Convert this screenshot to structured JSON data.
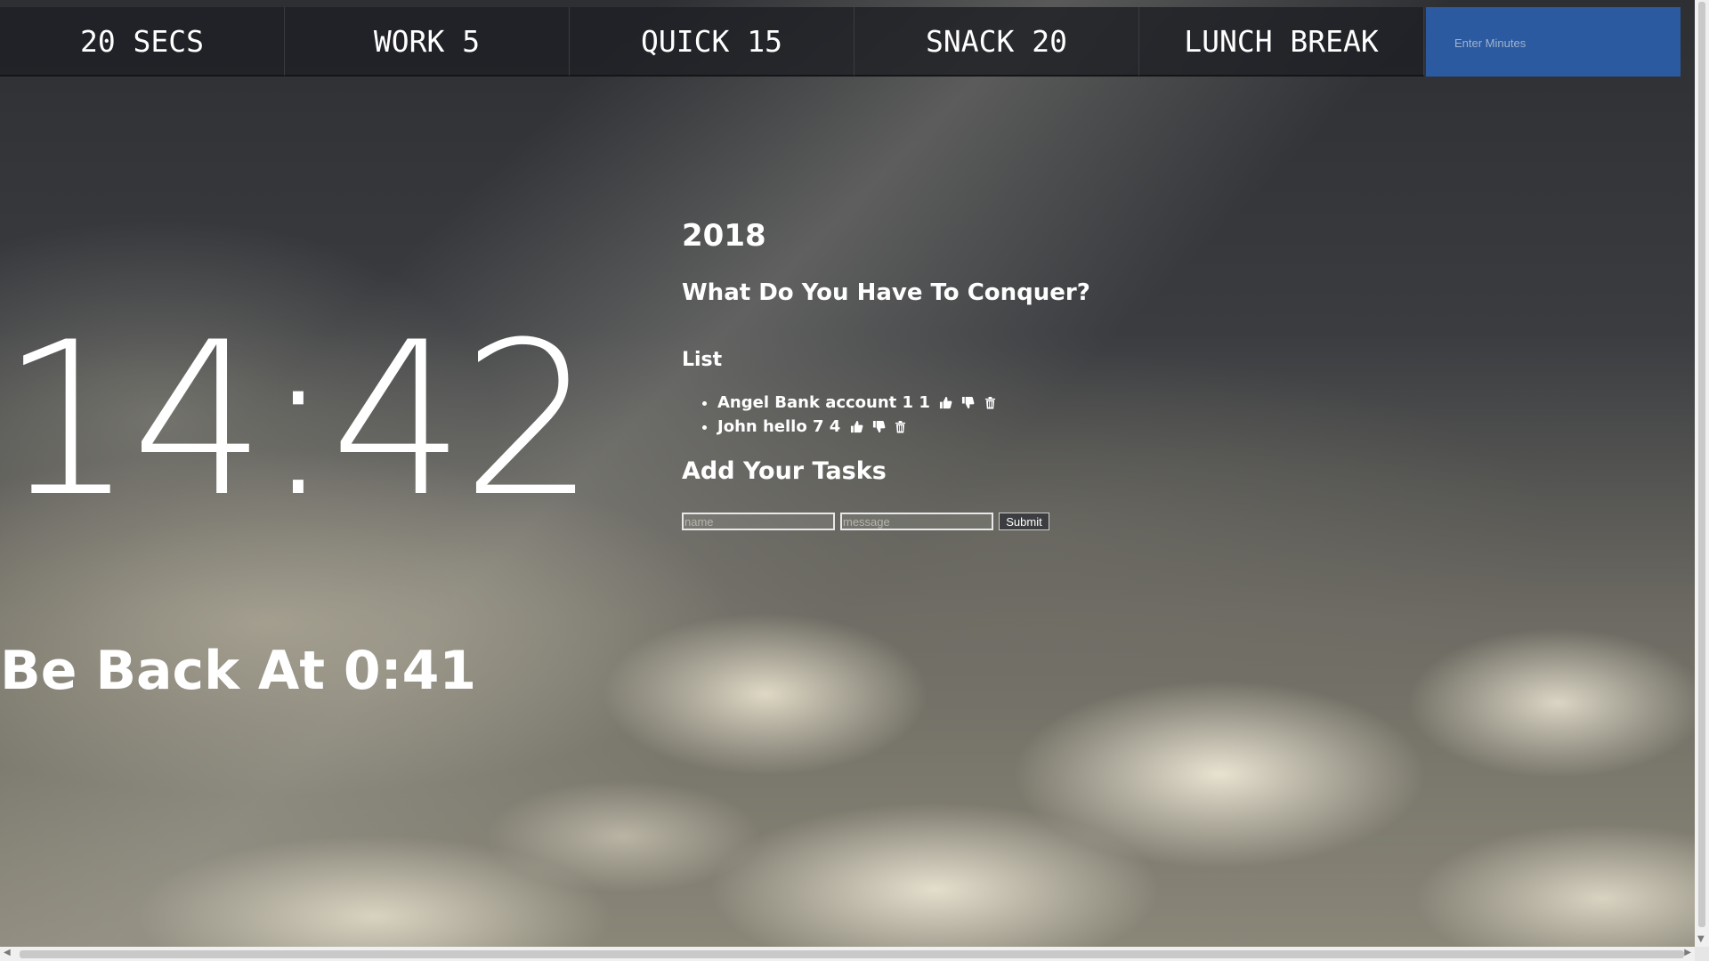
{
  "nav": {
    "buttons": [
      "20 SECS",
      "WORK 5",
      "QUICK 15",
      "SNACK 20",
      "LUNCH BREAK"
    ],
    "minutes_placeholder": "Enter Minutes",
    "accent_color": "#2b5aa0"
  },
  "clock": {
    "time": "14:42",
    "back_at": "Be Back At 0:41"
  },
  "panel": {
    "year": "2018",
    "question": "What Do You Have To Conquer?",
    "list_title": "List",
    "tasks": [
      {
        "text": "Angel Bank account 1 1",
        "icons": [
          "thumbs-up-icon",
          "thumbs-down-icon",
          "trash-icon"
        ]
      },
      {
        "text": "John hello 7 4",
        "icons": [
          "thumbs-up-icon",
          "thumbs-down-icon",
          "trash-icon"
        ]
      }
    ],
    "add_title": "Add Your Tasks",
    "form": {
      "name_placeholder": "name",
      "message_placeholder": "message",
      "submit_label": "Submit"
    }
  },
  "scrollbars": {
    "up": "▲",
    "down": "▼",
    "left": "◀",
    "right": "▶"
  }
}
